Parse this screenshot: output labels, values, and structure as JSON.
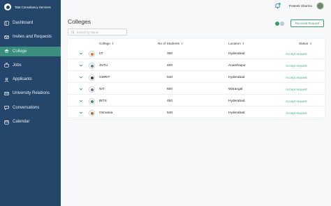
{
  "brand": {
    "name": "Tata Consultancy Services"
  },
  "sidebar": {
    "items": [
      {
        "label": "Dashboard",
        "icon": "dashboard-icon"
      },
      {
        "label": "Invites and Requests",
        "icon": "invites-icon"
      },
      {
        "label": "College",
        "icon": "college-icon",
        "active": true
      },
      {
        "label": "Jobs",
        "icon": "jobs-icon"
      },
      {
        "label": "Applicants",
        "icon": "applicants-icon"
      },
      {
        "label": "University Relations",
        "icon": "university-icon"
      },
      {
        "label": "Conversations",
        "icon": "conversations-icon"
      },
      {
        "label": "Calendar",
        "icon": "calendar-icon"
      }
    ]
  },
  "header": {
    "user_name": "Prateek Sharma"
  },
  "main": {
    "title": "Colleges",
    "received_label": "Received Request",
    "search_placeholder": "Search by Name",
    "columns": {
      "college": "College",
      "students": "No of Students",
      "location": "Location",
      "status": "Status"
    },
    "rows": [
      {
        "college": "IIT",
        "students": "300",
        "location": "Hyderabad",
        "action": "Accept request"
      },
      {
        "college": "JNTU",
        "students": "400",
        "location": "Ananthapur",
        "action": "Accept request"
      },
      {
        "college": "GMRIT",
        "students": "540",
        "location": "Hyderabad",
        "action": "Accept request"
      },
      {
        "college": "NIT",
        "students": "600",
        "location": "Warangal",
        "action": "Accept request"
      },
      {
        "college": "BITS",
        "students": "450",
        "location": "Hyderabad",
        "action": "Accept request"
      },
      {
        "college": "Osmania",
        "students": "540",
        "location": "Hyderabad",
        "action": "Accept request"
      }
    ]
  },
  "colors": {
    "sidebar_bg": "#24466b",
    "active_item": "#3a8f7e",
    "accent": "#3fb07e"
  }
}
